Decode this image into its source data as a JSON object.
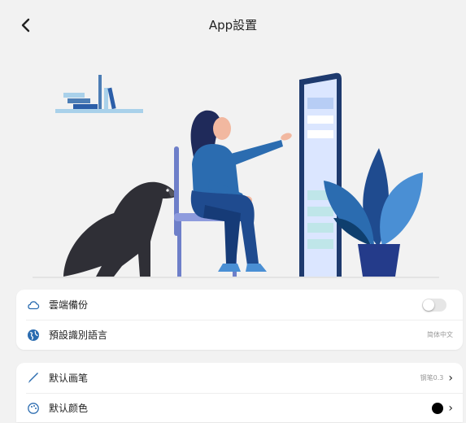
{
  "header": {
    "title": "App設置",
    "back_icon": "chevron-left-icon"
  },
  "hero": {
    "illustration": "woman-with-dog-touching-screen",
    "accent": "#2b6cb0"
  },
  "settings_group_1": [
    {
      "label": "雲端備份",
      "icon": "cloud-icon",
      "control": "toggle",
      "toggle_on": false
    },
    {
      "label": "預設識別語言",
      "icon": "globe-icon",
      "value": "简体中文"
    }
  ],
  "settings_group_2": [
    {
      "label": "默认画笔",
      "icon": "brush-icon",
      "value": "钢笔0.3"
    },
    {
      "label": "默认颜色",
      "icon": "palette-icon",
      "color": "#000000"
    }
  ]
}
